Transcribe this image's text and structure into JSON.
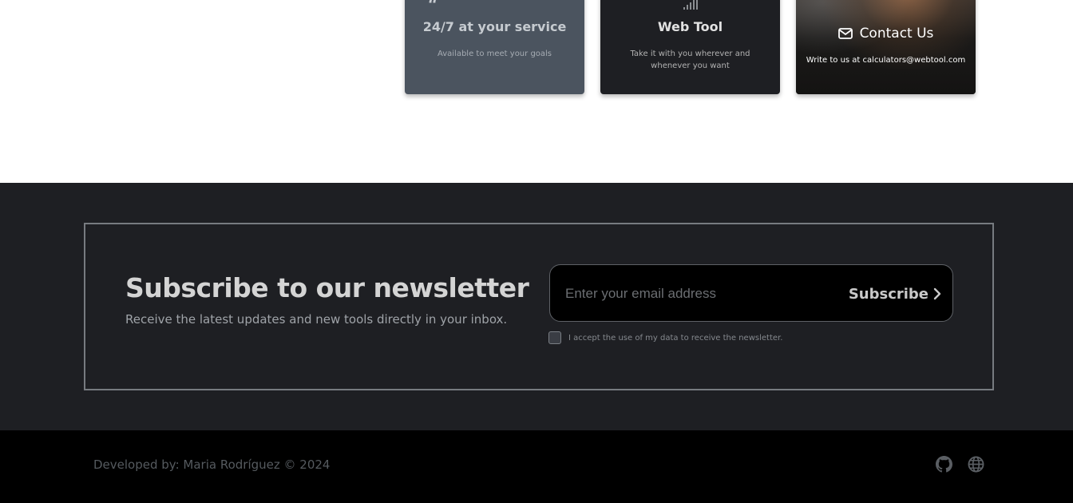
{
  "cards": [
    {
      "title": "24/7 at your service",
      "text": "Available to meet your goals",
      "icon": "quote-icon"
    },
    {
      "title": "Web Tool",
      "text": "Take it with you wherever and whenever you want",
      "icon": "signal-icon"
    },
    {
      "title": "Contact Us",
      "text": "Write to us at calculators@webtool.com",
      "icon": "envelope-icon"
    }
  ],
  "newsletter": {
    "title": "Subscribe to our newsletter",
    "subtitle": "Receive the latest updates and new tools directly in your inbox.",
    "email_placeholder": "Enter your email address",
    "subscribe_label": "Subscribe",
    "consent_label": "I accept the use of my data to receive the newsletter.",
    "consent_checked": false
  },
  "footer": {
    "credit": "Developed by: Maria Rodríguez © 2024",
    "icons": [
      "github-icon",
      "globe-icon"
    ]
  },
  "colors": {
    "page_bg": "#ffffff",
    "section_bg": "#1e1f23",
    "footer_bg": "#000000",
    "card_service_bg": "#4b545f",
    "card_web_bg": "#1e1f23"
  }
}
